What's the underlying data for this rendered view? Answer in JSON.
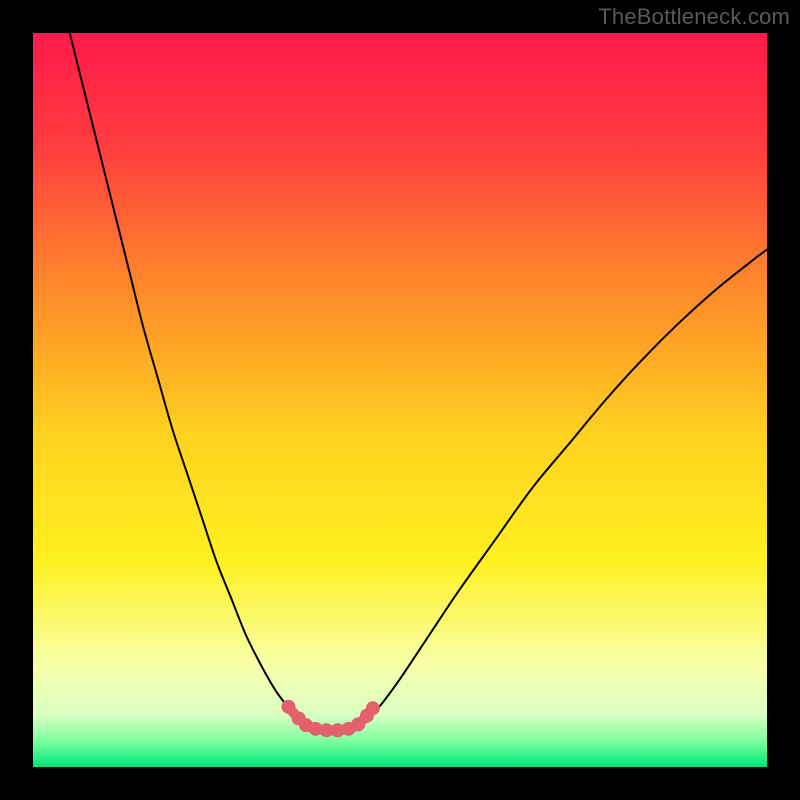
{
  "watermark": {
    "text": "TheBottleneck.com"
  },
  "chart_data": {
    "type": "line",
    "title": "",
    "xlabel": "",
    "ylabel": "",
    "xlim": [
      0,
      100
    ],
    "ylim": [
      0,
      100
    ],
    "grid": false,
    "legend": false,
    "background_gradient_stops": [
      {
        "pos": 0.0,
        "color": "#ff1a4b"
      },
      {
        "pos": 0.15,
        "color": "#ff3b3f"
      },
      {
        "pos": 0.35,
        "color": "#ff8a2a"
      },
      {
        "pos": 0.55,
        "color": "#ffd21f"
      },
      {
        "pos": 0.72,
        "color": "#fff020"
      },
      {
        "pos": 0.86,
        "color": "#f8ffa8"
      },
      {
        "pos": 0.93,
        "color": "#d9ffc2"
      },
      {
        "pos": 0.965,
        "color": "#7bff9e"
      },
      {
        "pos": 1.0,
        "color": "#00e57a"
      }
    ],
    "series": [
      {
        "name": "left-curve",
        "stroke": "#000000",
        "stroke_width": 2,
        "x": [
          5,
          7,
          9,
          11,
          13,
          15,
          17,
          19,
          21,
          23,
          25,
          27,
          29,
          31,
          33,
          34.5,
          36,
          37
        ],
        "y": [
          100,
          92,
          84,
          76,
          68,
          60,
          53,
          46,
          40,
          34,
          28,
          23,
          18,
          14,
          10.5,
          8.5,
          7,
          6.3
        ]
      },
      {
        "name": "right-curve",
        "stroke": "#000000",
        "stroke_width": 2,
        "x": [
          45,
          47,
          50,
          54,
          58,
          63,
          68,
          73,
          78,
          83,
          88,
          93,
          98,
          100
        ],
        "y": [
          6.3,
          8,
          12,
          18,
          24,
          31,
          38,
          44,
          50,
          55.5,
          60.5,
          65,
          69,
          70.5
        ]
      },
      {
        "name": "valley-markers",
        "stroke": "#e2616c",
        "marker_color": "#e2616c",
        "stroke_width": 10,
        "marker_radius": 7,
        "x": [
          34.8,
          36.2,
          37.2,
          38.5,
          40.0,
          41.5,
          43.0,
          44.3,
          45.5,
          46.3
        ],
        "y": [
          8.2,
          6.6,
          5.7,
          5.2,
          5.0,
          5.0,
          5.2,
          5.8,
          7.0,
          8.0
        ]
      }
    ]
  }
}
